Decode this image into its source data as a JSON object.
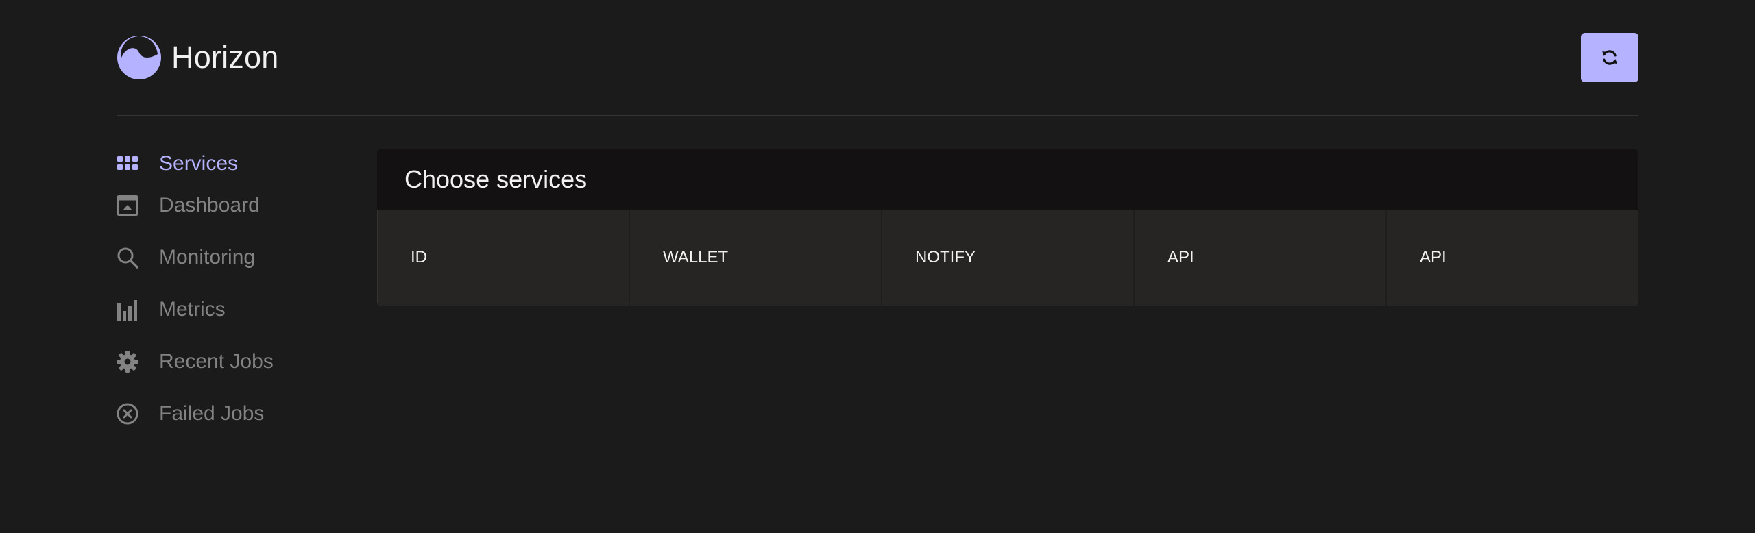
{
  "app": {
    "name": "Horizon",
    "accent_color": "#b5b2ff",
    "logo_icon": "horizon-logo-icon",
    "refresh_icon": "refresh-icon"
  },
  "sidebar": {
    "items": [
      {
        "label": "Services",
        "icon": "grid-icon",
        "active": true
      },
      {
        "label": "Dashboard",
        "icon": "dashboard-icon",
        "active": false
      },
      {
        "label": "Monitoring",
        "icon": "search-icon",
        "active": false
      },
      {
        "label": "Metrics",
        "icon": "bar-chart-icon",
        "active": false
      },
      {
        "label": "Recent Jobs",
        "icon": "gear-icon",
        "active": false
      },
      {
        "label": "Failed Jobs",
        "icon": "x-circle-icon",
        "active": false
      }
    ]
  },
  "main": {
    "title": "Choose services",
    "services": [
      "ID",
      "WALLET",
      "NOTIFY",
      "API",
      "API"
    ]
  }
}
